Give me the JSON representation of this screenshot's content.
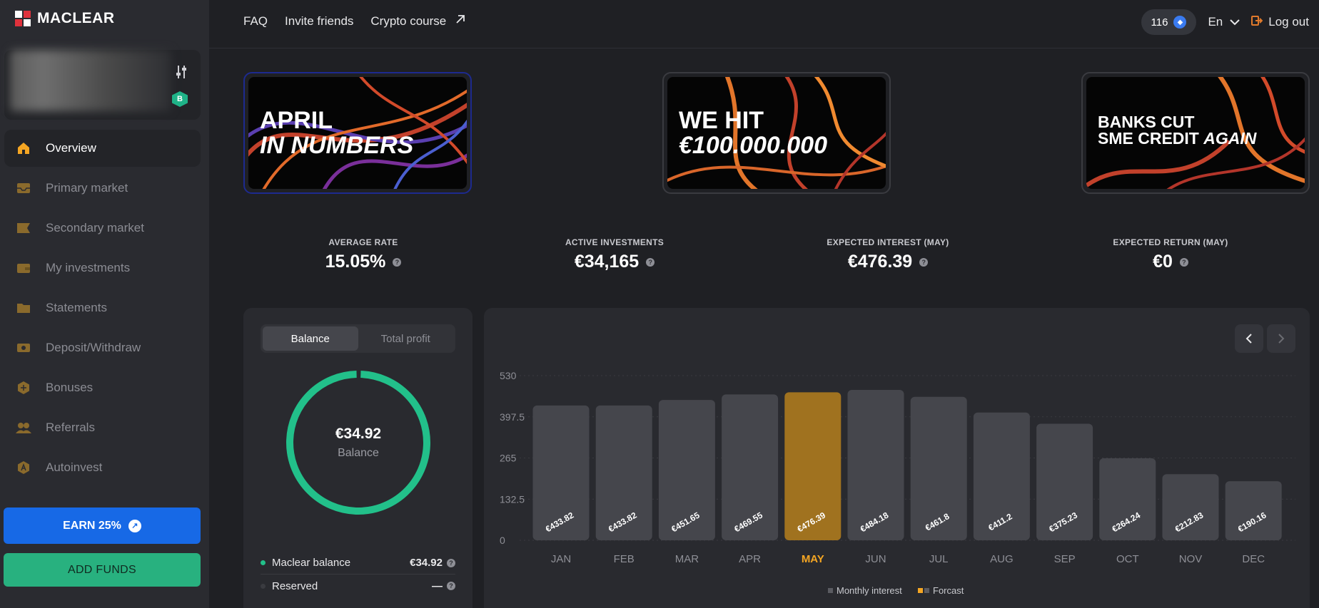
{
  "app": {
    "logo_text": "MACLEAR"
  },
  "colors": {
    "accent_orange": "#f5a623",
    "brand_blue": "#1769e6",
    "brand_green": "#28b17f",
    "donut_green": "#22c08a",
    "bar_gray": "#45464c",
    "bar_forecast": "#a0721f"
  },
  "topbar": {
    "links": [
      {
        "label": "FAQ"
      },
      {
        "label": "Invite friends"
      },
      {
        "label": "Crypto course",
        "icon": "external-arrow-icon"
      }
    ],
    "points": "116",
    "language": "En",
    "logout_label": "Log out"
  },
  "sidebar": {
    "profile_badge": "B",
    "items": [
      {
        "label": "Overview",
        "icon": "home-icon"
      },
      {
        "label": "Primary market",
        "icon": "inbox-icon"
      },
      {
        "label": "Secondary market",
        "icon": "tag-icon"
      },
      {
        "label": "My investments",
        "icon": "wallet-icon"
      },
      {
        "label": "Statements",
        "icon": "folder-icon"
      },
      {
        "label": "Deposit/Withdraw",
        "icon": "cash-icon"
      },
      {
        "label": "Bonuses",
        "icon": "gift-icon"
      },
      {
        "label": "Referrals",
        "icon": "users-icon"
      },
      {
        "label": "Autoinvest",
        "icon": "autoinvest-icon"
      }
    ],
    "earn_button": "EARN 25%",
    "add_funds_button": "ADD FUNDS"
  },
  "banners": [
    {
      "line1": "APRIL",
      "line2": "IN NUMBERS"
    },
    {
      "line1": "WE HIT",
      "line2": "€100.000.000"
    },
    {
      "line1": "BANKS CUT",
      "line2a": "SME CREDIT ",
      "line2b": "AGAIN"
    }
  ],
  "stats": [
    {
      "label": "AVERAGE RATE",
      "value": "15.05%"
    },
    {
      "label": "ACTIVE INVESTMENTS",
      "value": "€34,165"
    },
    {
      "label": "EXPECTED INTEREST (MAY)",
      "value": "€476.39"
    },
    {
      "label": "EXPECTED RETURN (MAY)",
      "value": "€0"
    }
  ],
  "balance": {
    "tabs": [
      "Balance",
      "Total profit"
    ],
    "active_tab": "Balance",
    "donut_value": "€34.92",
    "donut_label": "Balance",
    "donut_fill": 0.99,
    "legend": [
      {
        "label": "Maclear balance",
        "value": "€34.92"
      },
      {
        "label": "Reserved",
        "value": "—"
      }
    ]
  },
  "chart_data": {
    "type": "bar",
    "categories": [
      "JAN",
      "FEB",
      "MAR",
      "APR",
      "MAY",
      "JUN",
      "JUL",
      "AUG",
      "SEP",
      "OCT",
      "NOV",
      "DEC"
    ],
    "values": [
      433.82,
      433.82,
      451.65,
      469.55,
      476.39,
      484.18,
      461.8,
      411.2,
      375.23,
      264.24,
      212.83,
      190.16
    ],
    "value_labels": [
      "€433.82",
      "€433.82",
      "€451.65",
      "€469.55",
      "€476.39",
      "€484.18",
      "€461.8",
      "€411.2",
      "€375.23",
      "€264.24",
      "€212.83",
      "€190.16"
    ],
    "highlight_category": "MAY",
    "yticks": [
      "0",
      "132.5",
      "265",
      "397.5",
      "530"
    ],
    "ylim": [
      0,
      530
    ],
    "legend": [
      "Monthly interest",
      "Forcast"
    ],
    "legend_placement": "bottom-center",
    "grid": true
  }
}
